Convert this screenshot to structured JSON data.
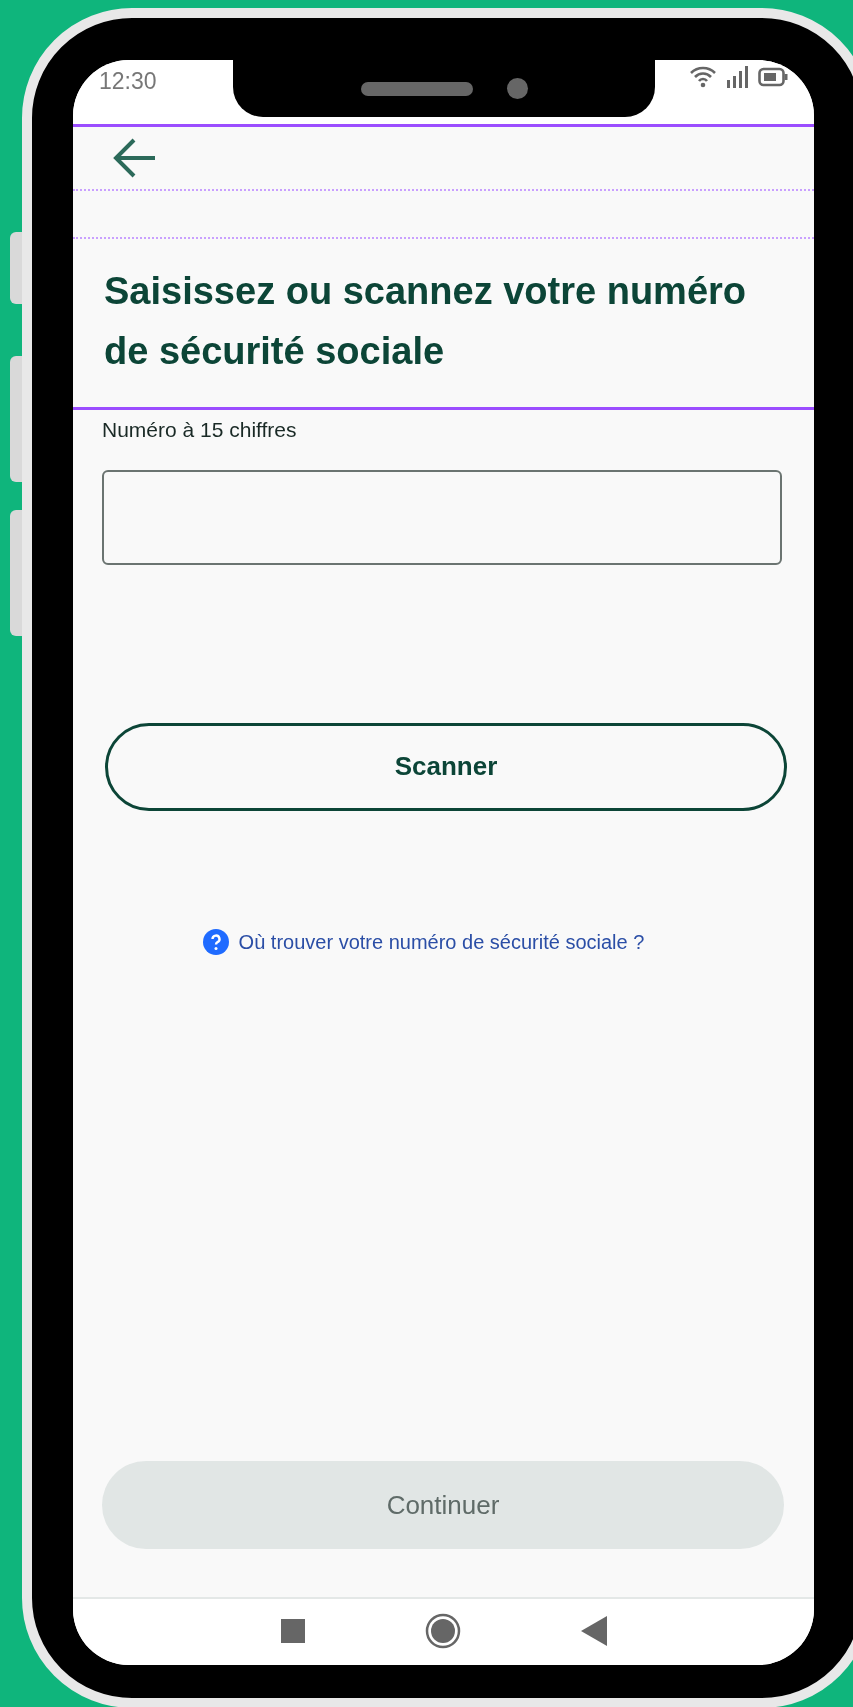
{
  "status_bar": {
    "time": "12:30"
  },
  "title": "Saisissez ou scannez votre numéro de sécurité sociale",
  "number_field": {
    "label": "Numéro à 15 chiffres"
  },
  "scan_button": {
    "label": "Scanner"
  },
  "help_link": {
    "label": "Où trouver votre numéro de sécurité sociale ?"
  },
  "continue_button": {
    "label": "Continuer",
    "disabled": true
  }
}
